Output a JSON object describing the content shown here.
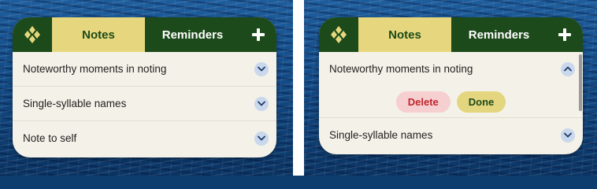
{
  "left_panel": {
    "tabs": {
      "notes": "Notes",
      "reminders": "Reminders"
    },
    "notes": [
      {
        "title": "Noteworthy moments in noting",
        "expanded": false
      },
      {
        "title": "Single-syllable names",
        "expanded": false
      },
      {
        "title": "Note to self",
        "expanded": false
      }
    ]
  },
  "right_panel": {
    "tabs": {
      "notes": "Notes",
      "reminders": "Reminders"
    },
    "notes": [
      {
        "title": "Noteworthy moments in noting",
        "expanded": true
      },
      {
        "title": "Single-syllable names",
        "expanded": false
      }
    ],
    "actions": {
      "delete": "Delete",
      "done": "Done"
    }
  },
  "colors": {
    "header_green": "#1c4a1a",
    "tab_active_yellow": "#e6d77e",
    "panel_background": "#f4f1e8",
    "chevron_bg": "#c9d8ec",
    "delete_bg": "#f6cfd0",
    "delete_text": "#c0262d",
    "done_bg": "#e3d67f"
  },
  "icons": {
    "app_logo": "four-diamond-logo-icon",
    "add": "plus-icon",
    "expand": "chevron-down-icon",
    "collapse": "chevron-up-icon"
  }
}
